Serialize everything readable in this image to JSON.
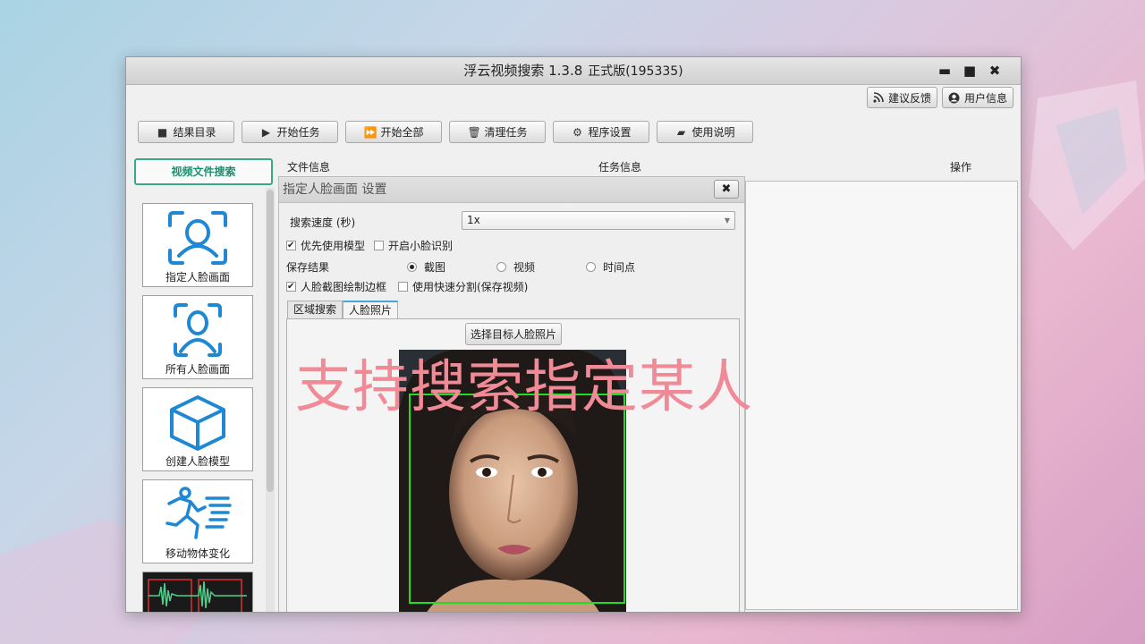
{
  "window": {
    "title": "浮云视频搜索 1.3.8",
    "edition": "正式版(195335)",
    "controls": {
      "minimize": "▬",
      "maximize": "■",
      "close": "✖"
    }
  },
  "top_buttons": {
    "feedback": {
      "label": "建议反馈",
      "icon": "rss-icon"
    },
    "user_info": {
      "label": "用户信息",
      "icon": "user-icon"
    }
  },
  "toolbar": [
    {
      "label": "结果目录",
      "icon": "folder-icon"
    },
    {
      "label": "开始任务",
      "icon": "play-icon"
    },
    {
      "label": "开始全部",
      "icon": "fast-forward-icon"
    },
    {
      "label": "清理任务",
      "icon": "trash-icon"
    },
    {
      "label": "程序设置",
      "icon": "gear-icon"
    },
    {
      "label": "使用说明",
      "icon": "book-icon"
    }
  ],
  "sidebar": {
    "category_tab": "视频文件搜索",
    "features": [
      {
        "label": "指定人脸画面",
        "icon": "face-scan-icon"
      },
      {
        "label": "所有人脸画面",
        "icon": "face-frame-icon"
      },
      {
        "label": "创建人脸模型",
        "icon": "cube-icon"
      },
      {
        "label": "移动物体变化",
        "icon": "running-person-icon"
      },
      {
        "label": "",
        "icon": "audio-waveform-icon"
      }
    ]
  },
  "columns": {
    "file_info": "文件信息",
    "task_info": "任务信息",
    "actions": "操作"
  },
  "dialog": {
    "title": "指定人脸画面 设置",
    "speed_label": "搜索速度 (秒)",
    "speed_value": "1x",
    "prefer_model": {
      "label": "优先使用模型",
      "checked": true
    },
    "small_face": {
      "label": "开启小脸识别",
      "checked": false
    },
    "save_result_label": "保存结果",
    "save_options": [
      {
        "label": "截图",
        "selected": true
      },
      {
        "label": "视频",
        "selected": false
      },
      {
        "label": "时间点",
        "selected": false
      }
    ],
    "draw_border": {
      "label": "人脸截图绘制边框",
      "checked": true
    },
    "fast_split": {
      "label": "使用快速分割(保存视频)",
      "checked": false
    },
    "tabs": [
      {
        "label": "区域搜索",
        "active": false
      },
      {
        "label": "人脸照片",
        "active": true
      }
    ],
    "select_photo_button": "选择目标人脸照片"
  },
  "overlay_caption": "支持搜索指定某人",
  "colors": {
    "accent_green": "#3aa789",
    "icon_blue": "#1e88d4",
    "caption_pink": "#f08a96",
    "face_box": "#22dd22"
  }
}
